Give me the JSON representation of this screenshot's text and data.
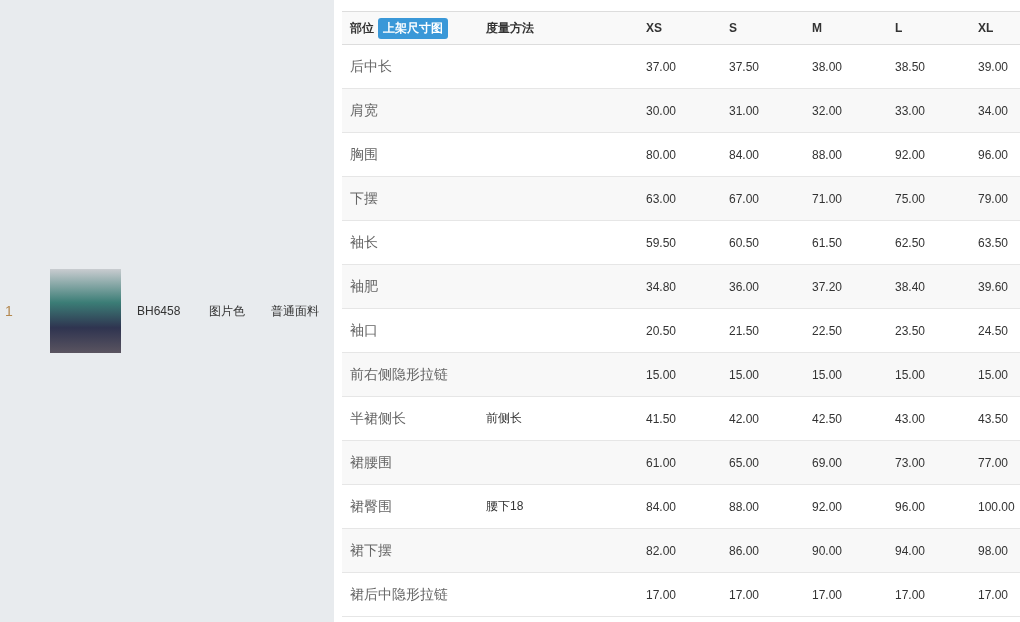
{
  "product": {
    "index": "1",
    "style_code": "BH6458",
    "color_label": "图片色",
    "fabric": "普通面料"
  },
  "size_table": {
    "part_heading": "部位",
    "badge": "上架尺寸图",
    "method_heading": "度量方法",
    "sizes": [
      "XS",
      "S",
      "M",
      "L",
      "XL"
    ],
    "rows": [
      {
        "part": "后中长",
        "values": [
          "37.00",
          "37.50",
          "38.00",
          "38.50",
          "39.00"
        ]
      },
      {
        "part": "肩宽",
        "values": [
          "30.00",
          "31.00",
          "32.00",
          "33.00",
          "34.00"
        ]
      },
      {
        "part": "胸围",
        "values": [
          "80.00",
          "84.00",
          "88.00",
          "92.00",
          "96.00"
        ]
      },
      {
        "part": "下摆",
        "values": [
          "63.00",
          "67.00",
          "71.00",
          "75.00",
          "79.00"
        ]
      },
      {
        "part": "袖长",
        "values": [
          "59.50",
          "60.50",
          "61.50",
          "62.50",
          "63.50"
        ]
      },
      {
        "part": "袖肥",
        "values": [
          "34.80",
          "36.00",
          "37.20",
          "38.40",
          "39.60"
        ]
      },
      {
        "part": "袖口",
        "values": [
          "20.50",
          "21.50",
          "22.50",
          "23.50",
          "24.50"
        ]
      },
      {
        "part": "前右侧隐形拉链",
        "values": [
          "15.00",
          "15.00",
          "15.00",
          "15.00",
          "15.00"
        ]
      },
      {
        "part": "半裙侧长",
        "method": "前侧长",
        "values": [
          "41.50",
          "42.00",
          "42.50",
          "43.00",
          "43.50"
        ]
      },
      {
        "part": "裙腰围",
        "values": [
          "61.00",
          "65.00",
          "69.00",
          "73.00",
          "77.00"
        ]
      },
      {
        "part": "裙臀围",
        "method": "腰下18",
        "values": [
          "84.00",
          "88.00",
          "92.00",
          "96.00",
          "100.00"
        ]
      },
      {
        "part": "裙下摆",
        "values": [
          "82.00",
          "86.00",
          "90.00",
          "94.00",
          "98.00"
        ]
      },
      {
        "part": "裙后中隐形拉链",
        "values": [
          "17.00",
          "17.00",
          "17.00",
          "17.00",
          "17.00"
        ]
      }
    ]
  }
}
